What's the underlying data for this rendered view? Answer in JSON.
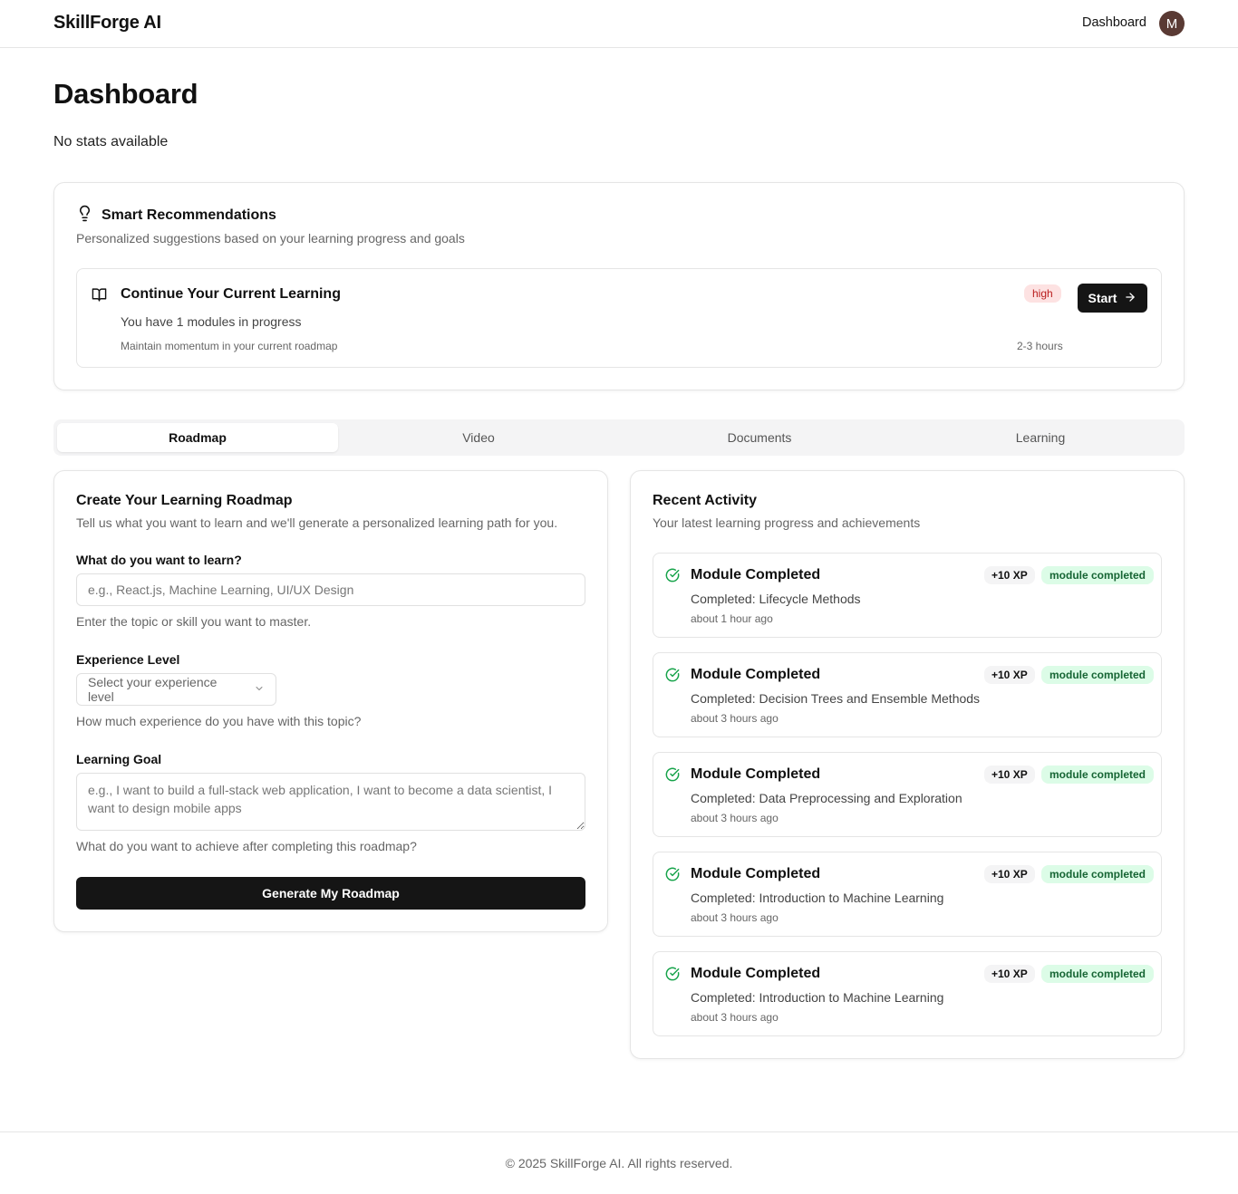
{
  "header": {
    "brand": "SkillForge AI",
    "nav_dashboard": "Dashboard",
    "avatar_initial": "M"
  },
  "page": {
    "title": "Dashboard",
    "stats_text": "No stats available"
  },
  "recommendations": {
    "title": "Smart Recommendations",
    "subtitle": "Personalized suggestions based on your learning progress and goals",
    "item": {
      "title": "Continue Your Current Learning",
      "description": "You have 1 modules in progress",
      "note": "Maintain momentum in your current roadmap",
      "priority": "high",
      "duration": "2-3 hours",
      "button": "Start"
    }
  },
  "tabs": [
    {
      "label": "Roadmap",
      "active": true
    },
    {
      "label": "Video",
      "active": false
    },
    {
      "label": "Documents",
      "active": false
    },
    {
      "label": "Learning",
      "active": false
    }
  ],
  "roadmap_form": {
    "title": "Create Your Learning Roadmap",
    "subtitle": "Tell us what you want to learn and we'll generate a personalized learning path for you.",
    "topic_label": "What do you want to learn?",
    "topic_placeholder": "e.g., React.js, Machine Learning, UI/UX Design",
    "topic_value": "",
    "topic_hint": "Enter the topic or skill you want to master.",
    "level_label": "Experience Level",
    "level_value": "Select your experience level",
    "level_hint": "How much experience do you have with this topic?",
    "goal_label": "Learning Goal",
    "goal_placeholder": "e.g., I want to build a full-stack web application, I want to become a data scientist, I want to design mobile apps",
    "goal_value": "",
    "goal_hint": "What do you want to achieve after completing this roadmap?",
    "submit": "Generate My Roadmap"
  },
  "activity": {
    "title": "Recent Activity",
    "subtitle": "Your latest learning progress and achievements",
    "items": [
      {
        "title": "Module Completed",
        "description": "Completed: Lifecycle Methods",
        "time": "about 1 hour ago",
        "xp": "+10 XP",
        "tag": "module completed"
      },
      {
        "title": "Module Completed",
        "description": "Completed: Decision Trees and Ensemble Methods",
        "time": "about 3 hours ago",
        "xp": "+10 XP",
        "tag": "module completed"
      },
      {
        "title": "Module Completed",
        "description": "Completed: Data Preprocessing and Exploration",
        "time": "about 3 hours ago",
        "xp": "+10 XP",
        "tag": "module completed"
      },
      {
        "title": "Module Completed",
        "description": "Completed: Introduction to Machine Learning",
        "time": "about 3 hours ago",
        "xp": "+10 XP",
        "tag": "module completed"
      },
      {
        "title": "Module Completed",
        "description": "Completed: Introduction to Machine Learning",
        "time": "about 3 hours ago",
        "xp": "+10 XP",
        "tag": "module completed"
      }
    ]
  },
  "footer": {
    "text": "© 2025 SkillForge AI. All rights reserved."
  },
  "colors": {
    "primary": "#151515",
    "high_badge_bg": "#fde2e2",
    "high_badge_text": "#b91c1c",
    "success_badge_bg": "#dcfce7",
    "success_badge_text": "#166534",
    "check_icon": "#16a34a",
    "avatar_bg": "#5a3a34"
  },
  "icons": {
    "recommendations": "lightbulb-icon",
    "recommendation_item": "book-open-icon",
    "start_button": "arrow-right-icon",
    "select": "chevron-down-icon",
    "activity": "circle-check-icon"
  }
}
